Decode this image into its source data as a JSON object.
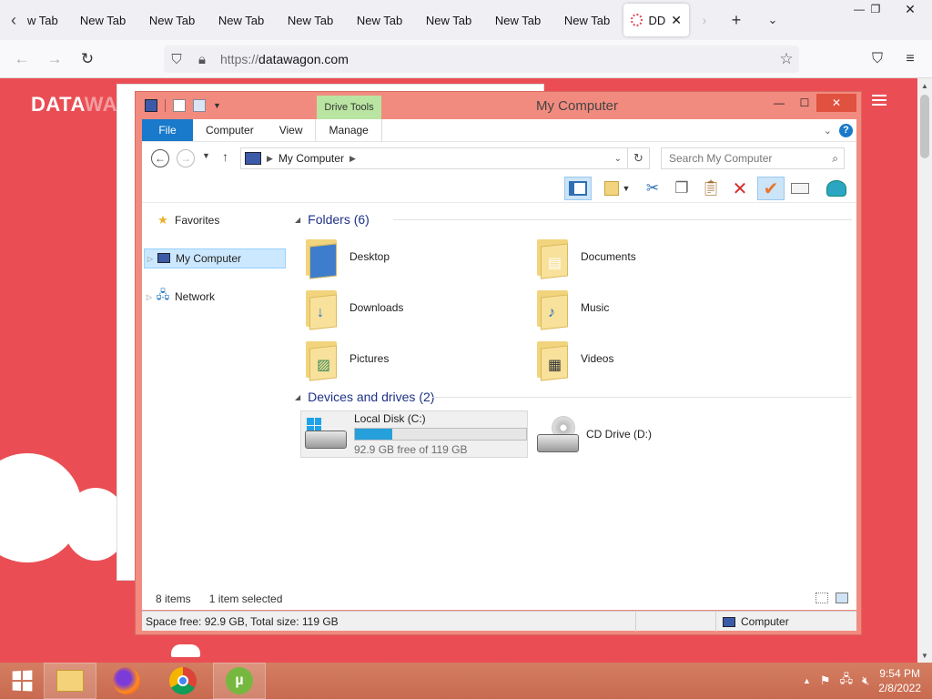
{
  "browser": {
    "tabs": [
      "w Tab",
      "New Tab",
      "New Tab",
      "New Tab",
      "New Tab",
      "New Tab",
      "New Tab",
      "New Tab",
      "New Tab"
    ],
    "active_tab": "DD",
    "url_scheme": "https://",
    "url_host": "datawagon.com"
  },
  "site": {
    "logo_main": "DATA",
    "logo_faded": "WA"
  },
  "explorer": {
    "title": "My Computer",
    "drive_tools": "Drive Tools",
    "ribbon_tabs": {
      "file": "File",
      "computer": "Computer",
      "view": "View",
      "manage": "Manage"
    },
    "help": "?",
    "address_location": "My Computer",
    "search_placeholder": "Search My Computer",
    "nav": {
      "favorites": "Favorites",
      "my_computer": "My Computer",
      "network": "Network"
    },
    "folders_header": "Folders (6)",
    "folders": [
      "Desktop",
      "Documents",
      "Downloads",
      "Music",
      "Pictures",
      "Videos"
    ],
    "drives_header": "Devices and drives (2)",
    "local_disk": {
      "name": "Local Disk (C:)",
      "free_text": "92.9 GB free of 119 GB",
      "used_fraction": 0.22
    },
    "cd_drive": {
      "name": "CD Drive (D:)"
    },
    "status_items": "8 items",
    "status_selected": "1 item selected",
    "bottom_left": "Space free: 92.9 GB, Total size: 119 GB",
    "bottom_right": "Computer"
  },
  "taskbar": {
    "time": "9:54 PM",
    "date": "2/8/2022"
  },
  "colors": {
    "page_bg": "#ea4e54",
    "ribbon_file": "#1979ca",
    "drive_tools": "#b9e4a1",
    "progress": "#26a0da"
  }
}
